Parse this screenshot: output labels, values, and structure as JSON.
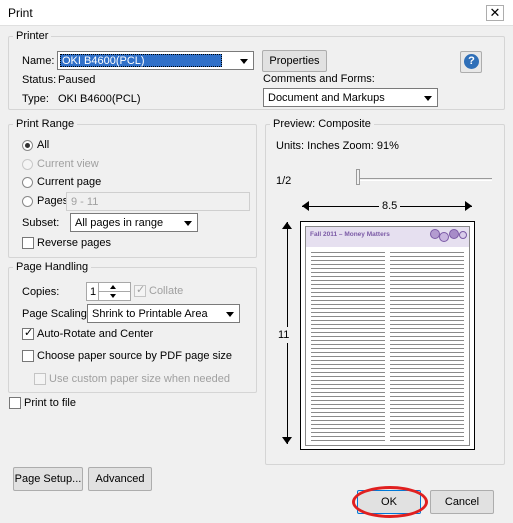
{
  "window": {
    "title": "Print",
    "close_glyph": "✕"
  },
  "printer": {
    "legend": "Printer",
    "name_label": "Name:",
    "name_value": "OKI B4600(PCL)",
    "properties_label": "Properties",
    "help_icon": "?",
    "status_label": "Status:",
    "status_value": "Paused",
    "type_label": "Type:",
    "type_value": "OKI B4600(PCL)",
    "comments_label": "Comments and Forms:",
    "comments_value": "Document and Markups"
  },
  "print_range": {
    "legend": "Print Range",
    "all": "All",
    "current_view": "Current view",
    "current_page": "Current page",
    "pages": "Pages",
    "pages_value": "9 - 11",
    "selected": "all",
    "subset_label": "Subset:",
    "subset_value": "All pages in range",
    "reverse_pages": "Reverse pages",
    "reverse_checked": false
  },
  "page_handling": {
    "legend": "Page Handling",
    "copies_label": "Copies:",
    "copies_value": "1",
    "collate": "Collate",
    "collate_checked": true,
    "scaling_label": "Page Scaling:",
    "scaling_value": "Shrink to Printable Area",
    "auto_rotate": "Auto-Rotate and Center",
    "auto_rotate_checked": true,
    "choose_source": "Choose paper source by PDF page size",
    "choose_source_checked": false,
    "custom_paper": "Use custom paper size when needed",
    "custom_paper_checked": false
  },
  "print_to_file": {
    "label": "Print to file",
    "checked": false
  },
  "preview": {
    "legend": "Preview: Composite",
    "units_line": "Units: Inches Zoom:  91%",
    "page_counter": "1/2",
    "width_dim": "8.5",
    "height_dim": "11",
    "doc_header": "Fall 2011 – Money Matters",
    "header_color": "#7b5aa6"
  },
  "buttons": {
    "page_setup": "Page Setup...",
    "advanced": "Advanced",
    "ok": "OK",
    "cancel": "Cancel",
    "highlight_color": "#e02020"
  }
}
